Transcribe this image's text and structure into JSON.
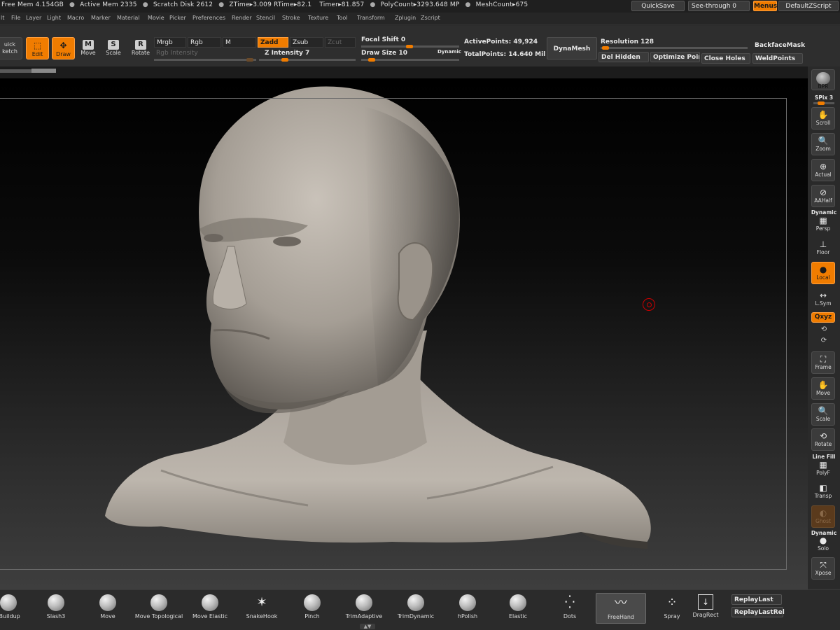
{
  "status": {
    "items": [
      "Free Mem 4.154GB",
      "Active Mem 2335",
      "Scratch Disk 2612",
      "ZTime▸3.009 RTime▸82.1",
      "Timer▸81.857",
      "PolyCount▸3293.648 MP",
      "MeshCount▸675"
    ],
    "quicksave": "QuickSave",
    "see_through": "See-through  0",
    "menus": "Menus",
    "default_zscript": "DefaultZScript"
  },
  "menubar": [
    "lt",
    "File",
    "Layer",
    "Light",
    "Macro",
    "Marker",
    "Material",
    "Movie",
    "Picker",
    "Preferences",
    "Render",
    "Stencil",
    "Stroke",
    "Texture",
    "Tool",
    "Transform",
    "Zplugin",
    "Zscript"
  ],
  "shelf": {
    "quick_sketch": "uick\nketch",
    "edit": "Edit",
    "draw": "Draw",
    "move": "Move",
    "scale": "Scale",
    "rotate": "Rotate",
    "mrgb": "Mrgb",
    "rgb": "Rgb",
    "m": "M",
    "rgb_intensity": "Rgb Intensity",
    "zadd": "Zadd",
    "zsub": "Zsub",
    "zcut": "Zcut",
    "z_intensity": "Z Intensity 7",
    "focal_shift": "Focal Shift 0",
    "draw_size": "Draw Size 10",
    "dynamic": "Dynamic",
    "active_points": "ActivePoints: 49,924",
    "total_points": "TotalPoints: 14.640 Mil",
    "dynamesh": "DynaMesh",
    "resolution": "Resolution 128",
    "del_hidden": "Del Hidden",
    "optimize_points": "Optimize Poin",
    "close_holes": "Close Holes",
    "backface_mask": "BackfaceMask",
    "weld_points": "WeldPoints"
  },
  "right_tray": {
    "bpr": "BPR",
    "spix": "SPix 3",
    "scroll": "Scroll",
    "zoom": "Zoom",
    "actual": "Actual",
    "aahalf": "AAHalf",
    "dynamic": "Dynamic",
    "persp": "Persp",
    "floor": "Floor",
    "local": "Local",
    "lsym": "L.Sym",
    "xyz": "Qxyz",
    "frame": "Frame",
    "move": "Move",
    "scale": "Scale",
    "rotate": "Rotate",
    "line_fill": "Line Fill",
    "polyf": "PolyF",
    "transp": "Transp",
    "ghost": "Ghost",
    "dynamic2": "Dynamic",
    "solo": "Solo",
    "xpose": "Xpose"
  },
  "brushes": [
    "rBuildup",
    "Slash3",
    "Move",
    "Move Topological",
    "Move Elastic",
    "SnakeHook",
    "Pinch",
    "TrimAdaptive",
    "TrimDynamic",
    "hPolish",
    "Elastic",
    "Dots",
    "FreeHand",
    "Spray",
    "DragRect"
  ],
  "replay": {
    "replay_last": "ReplayLast",
    "replay_last_rel": "ReplayLastRel"
  },
  "colors": {
    "accent": "#f07c00",
    "panel": "#2e2e2e",
    "clay": "#a9a29a"
  },
  "strip_progress": 0.45
}
